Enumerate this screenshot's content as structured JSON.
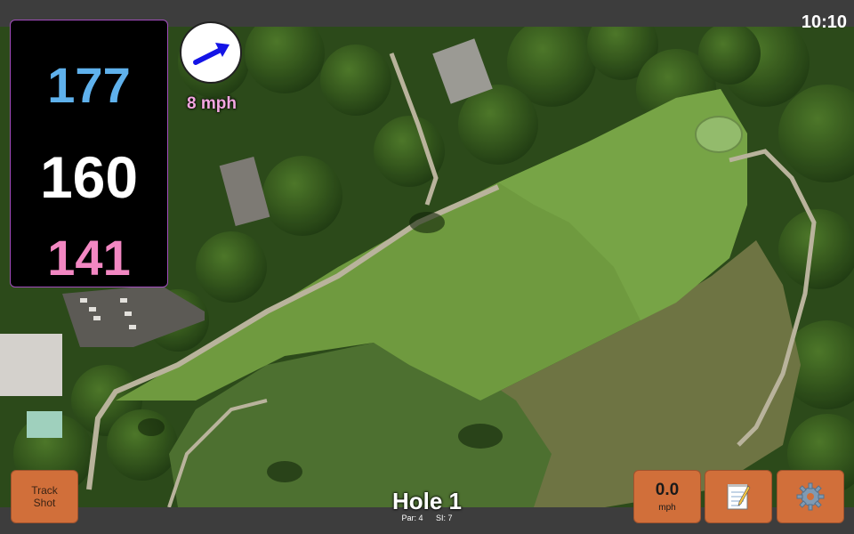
{
  "status": {
    "time": "10:10"
  },
  "distances": {
    "back": "177",
    "middle": "160",
    "front": "141"
  },
  "wind": {
    "speed": "8 mph",
    "direction_icon": "wind-arrow-icon"
  },
  "hole": {
    "title": "Hole 1",
    "par": "Par: 4",
    "stroke_index": "SI: 7"
  },
  "buttons": {
    "track_shot_line1": "Track",
    "track_shot_line2": "Shot",
    "speed_value": "0.0",
    "speed_unit": "mph",
    "notes_icon": "notepad-icon",
    "settings_icon": "gear-icon"
  },
  "colors": {
    "back_distance": "#5fb1ec",
    "middle_distance": "#ffffff",
    "front_distance": "#f287c2",
    "button": "#d16f3a",
    "wind_text": "#f3a6e0"
  }
}
